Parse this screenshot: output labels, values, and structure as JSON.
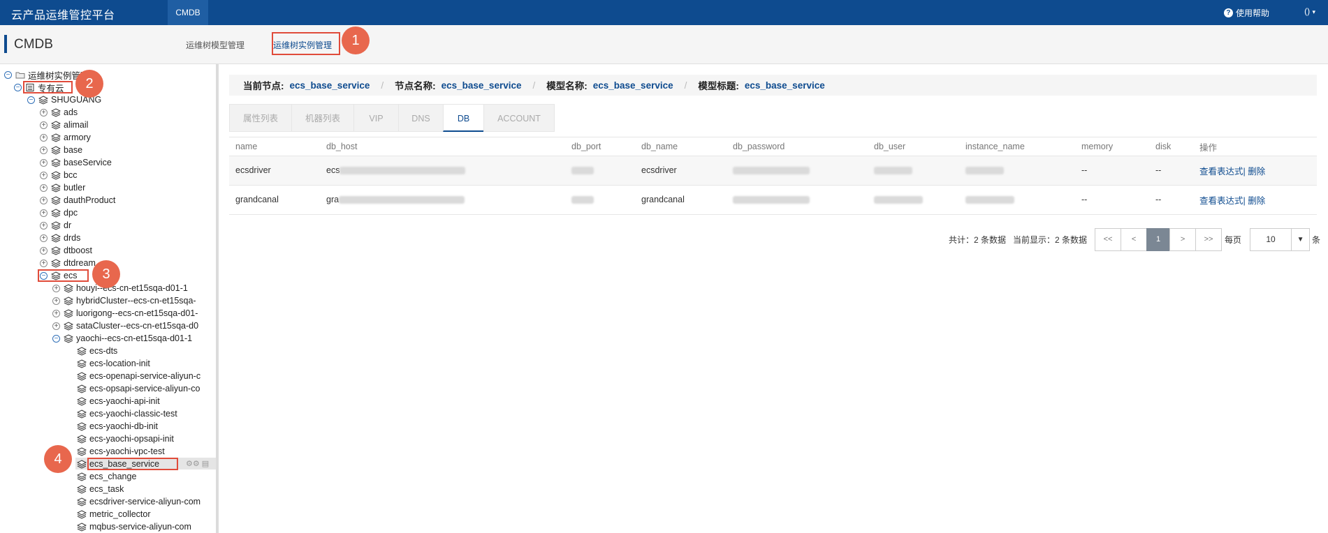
{
  "topbar": {
    "brand": "云产品运维管控平台",
    "nav_tab": "CMDB",
    "help": "使用帮助",
    "user_menu": "()"
  },
  "header": {
    "title": "CMDB",
    "tabs": [
      {
        "label": "运维树模型管理"
      },
      {
        "label": "运维树实例管理"
      }
    ]
  },
  "tree": {
    "root": "运维树实例管理",
    "region": "专有云",
    "cluster": "SHUGUANG",
    "products": [
      "ads",
      "alimail",
      "armory",
      "base",
      "baseService",
      "bcc",
      "butler",
      "dauthProduct",
      "dpc",
      "dr",
      "drds",
      "dtboost",
      "dtdream",
      "ecs"
    ],
    "ecs_children": [
      "houyi--ecs-cn-et15sqa-d01-1",
      "hybridCluster--ecs-cn-et15sqa-",
      "luorigong--ecs-cn-et15sqa-d01-",
      "sataCluster--ecs-cn-et15sqa-d0",
      "yaochi--ecs-cn-et15sqa-d01-1"
    ],
    "yaochi_children": [
      "ecs-dts",
      "ecs-location-init",
      "ecs-openapi-service-aliyun-c",
      "ecs-opsapi-service-aliyun-co",
      "ecs-yaochi-api-init",
      "ecs-yaochi-classic-test",
      "ecs-yaochi-db-init",
      "ecs-yaochi-opsapi-init",
      "ecs-yaochi-vpc-test",
      "ecs_base_service",
      "ecs_change",
      "ecs_task",
      "ecsdriver-service-aliyun-com",
      "metric_collector",
      "mqbus-service-aliyun-com"
    ]
  },
  "info": {
    "current_node_label": "当前节点:",
    "current_node": "ecs_base_service",
    "node_name_label": "节点名称:",
    "node_name": "ecs_base_service",
    "model_name_label": "模型名称:",
    "model_name": "ecs_base_service",
    "model_title_label": "模型标题:",
    "model_title": "ecs_base_service"
  },
  "tabs": [
    {
      "label": "属性列表"
    },
    {
      "label": "机器列表"
    },
    {
      "label": "VIP"
    },
    {
      "label": "DNS"
    },
    {
      "label": "DB"
    },
    {
      "label": "ACCOUNT"
    }
  ],
  "table": {
    "columns": [
      "name",
      "db_host",
      "db_port",
      "db_name",
      "db_password",
      "db_user",
      "instance_name",
      "memory",
      "disk",
      "操作"
    ],
    "rows": [
      {
        "name": "ecsdriver",
        "db_host_prefix": "ecs",
        "db_name": "ecsdriver",
        "memory": "--",
        "disk": "--",
        "action_view": "查看表达式",
        "action_delete": "删除"
      },
      {
        "name": "grandcanal",
        "db_host_prefix": "gra",
        "db_name": "grandcanal",
        "memory": "--",
        "disk": "--",
        "action_view": "查看表达式",
        "action_delete": "删除"
      }
    ]
  },
  "pager": {
    "total": "共计：2 条数据",
    "showing": "当前显示：2 条数据",
    "first": "<<",
    "prev": "<",
    "current": "1",
    "next": ">",
    "last": ">>",
    "per_page_label": "每页",
    "per_page": "10",
    "unit": "条"
  },
  "annotations": [
    "1",
    "2",
    "3",
    "4"
  ],
  "colors": {
    "topbar": "#0e4b8f",
    "accent": "#0e4b8f",
    "badge": "#e8674d",
    "highlight": "#e04b3a"
  }
}
